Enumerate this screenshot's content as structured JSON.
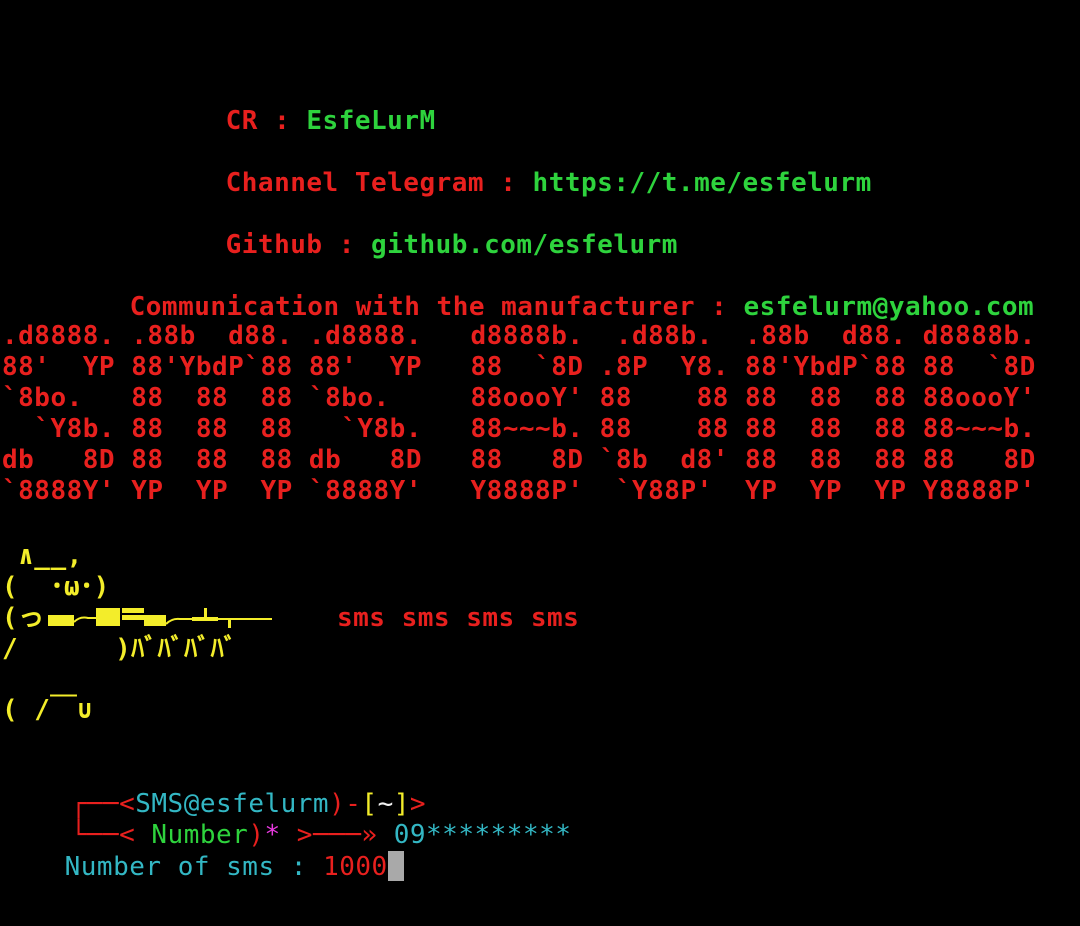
{
  "header": {
    "cr_label": "CR : ",
    "cr_value": "EsfeLurM",
    "telegram_label": "Channel Telegram : ",
    "telegram_value": "https://t.me/esfelurm",
    "github_label": "Github : ",
    "github_value": "github.com/esfelurm",
    "contact_label": "Communication with the manufacturer : ",
    "contact_value": "esfelurm@yahoo.com"
  },
  "banner": [
    ".d8888. .88b  d88. .d8888.   d8888b.  .d88b.  .88b  d88. d8888b.",
    "88'  YP 88'YbdP`88 88'  YP   88  `8D .8P  Y8. 88'YbdP`88 88  `8D",
    "`8bo.   88  88  88 `8bo.     88oooY' 88    88 88  88  88 88oooY'",
    "  `Y8b. 88  88  88   `Y8b.   88~~~b. 88    88 88  88  88 88~~~b.",
    "db   8D 88  88  88 db   8D   88   8D `8b  d8' 88  88  88 88   8D",
    "`8888Y' YP  YP  YP `8888Y'   Y8888P'  `Y88P'  YP  YP  YP Y8888P'"
  ],
  "cat_art": {
    "line1": " ∧__,",
    "line2": "(  ･ω･)",
    "line3": "(っ",
    "line4": "/      )ﾊﾞﾊﾞﾊﾞﾊﾞ",
    "line5": "( /￣∪"
  },
  "sms_text": "sms sms sms sms",
  "prompt": {
    "corner_top": "┌──",
    "user_host": "<SMS@esfelurm)-",
    "user_host_open": "<",
    "user_host_name": "SMS@esfelurm",
    "user_host_close": ")-",
    "dir_open": "[",
    "dir": "~",
    "dir_close": "]",
    "end_arrow": ">",
    "corner_bottom": "└──",
    "number_open": "< ",
    "number_label": "Number",
    "number_close": ")",
    "asterisk": "*",
    "arrow": " >───»",
    "number_value": " 09*********",
    "sms_count_label": "Number of sms : ",
    "sms_count_value": "1000"
  },
  "colors": {
    "background": "#000000",
    "label_red": "#e8201e",
    "value_green": "#2ed33d",
    "art_yellow": "#f3ed2a",
    "prompt_cyan": "#33b7c4",
    "asterisk_magenta": "#e83ae0",
    "cursor_gray": "#a9a9a9"
  }
}
